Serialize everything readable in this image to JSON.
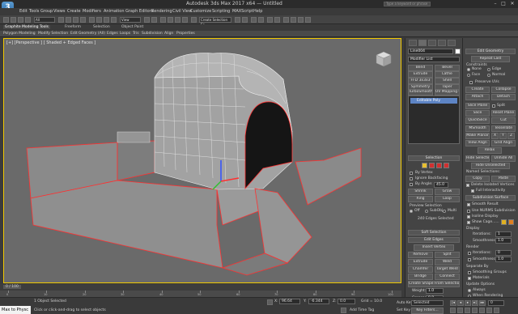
{
  "app": {
    "title": "Autodesk 3ds Max 2017 x64 — Untitled",
    "search_placeholder": "Type a keyword or phrase",
    "logo_letter": "3",
    "workspace": "Workspace: Default"
  },
  "menubar": [
    "Edit",
    "Tools",
    "Group",
    "Views",
    "Create",
    "Modifiers",
    "Animation",
    "Graph Editors",
    "Rendering",
    "Civil View",
    "Customize",
    "Scripting",
    "MAXScript",
    "Help"
  ],
  "toolbar": {
    "filter": "All",
    "view": "View",
    "create_selection_set": "Create Selection Se"
  },
  "ribbon": {
    "tabs": [
      "Graphite Modeling Tools",
      "Freeform",
      "Selection",
      "Object Paint"
    ],
    "active_tab": "Graphite Modeling Tools",
    "subtabs": [
      "Polygon Modeling",
      "Modify Selection",
      "Edit",
      "Geometry (All)",
      "Edges",
      "Loops",
      "Tris",
      "Subdivision",
      "Align",
      "Properties"
    ]
  },
  "viewport": {
    "label": "[+] [Perspective ] [ Shaded + Edged Faces ]"
  },
  "command_panel": {
    "object_name": "Line004",
    "modifier_list": "Modifier List",
    "modifier_buttons": [
      [
        "Bend",
        "Bevel"
      ],
      [
        "Extrude",
        "Lathe"
      ],
      [
        "FFD 3x3x3",
        "Shell"
      ],
      [
        "Symmetry",
        "Taper"
      ],
      [
        "TurboSmooth",
        "UV Mapping Cle"
      ]
    ],
    "stack_item": "Editable Poly",
    "selection": {
      "title": "Selection",
      "by_vertex": "By Vertex",
      "ignore_backfacing": "Ignore Backfacing",
      "by_angle": "By Angle:",
      "angle_value": "45.0",
      "shrink": "Shrink",
      "grow": "Grow",
      "ring": "Ring",
      "loop": "Loop",
      "preview_selection": "Preview Selection",
      "preview_off": "Off",
      "preview_subobj": "SubObj",
      "preview_multi": "Multi",
      "status": "240 Edges Selected"
    },
    "soft_selection": "Soft Selection",
    "edit_edges": {
      "title": "Edit Edges",
      "insert_vertex": "Insert Vertex",
      "remove": "Remove",
      "split": "Split",
      "extrude": "Extrude",
      "weld": "Weld",
      "chamfer": "Chamfer",
      "target_weld": "Target Weld",
      "bridge": "Bridge",
      "connect": "Connect",
      "create_shape": "Create Shape From Selection",
      "weight_label": "Weight:",
      "weight_value": "1.0",
      "crease_label": "Crease:",
      "crease_value": "0.0"
    }
  },
  "right_panel": {
    "edit_geometry": "Edit Geometry",
    "repeat_last": "Repeat Last",
    "constraints": "Constraints",
    "c_none": "None",
    "c_edge": "Edge",
    "c_face": "Face",
    "c_normal": "Normal",
    "preserve_uvs": "Preserve UVs",
    "create": "Create",
    "collapse": "Collapse",
    "attach": "Attach",
    "detach": "Detach",
    "slice_plane": "Slice Plane",
    "split": "Split",
    "slice": "Slice",
    "reset_plane": "Reset Plane",
    "quickslice": "QuickSlice",
    "cut": "Cut",
    "msmooth": "MSmooth",
    "tessellate": "Tessellate",
    "make_planar": "Make Planar",
    "x": "X",
    "y": "Y",
    "z": "Z",
    "view_align": "View Align",
    "grid_align": "Grid Align",
    "relax": "Relax",
    "hide_selected": "Hide Selected",
    "unhide_all": "Unhide All",
    "hide_unselected": "Hide Unselected",
    "named_selections": "Named Selections:",
    "copy": "Copy",
    "paste": "Paste",
    "delete_isolated": "Delete Isolated Vertices",
    "full_interactivity": "Full Interactivity",
    "subdivision_surface": "Subdivision Surface",
    "smooth_result": "Smooth Result",
    "use_nurms": "Use NURMS Subdivision",
    "isoline_display": "Isoline Display",
    "show_cage": "Show Cage......",
    "display": "Display",
    "iterations_label": "Iterations:",
    "iterations_value": "1",
    "smoothness_label": "Smoothness:",
    "smoothness_value": "1.0",
    "render": "Render",
    "r_iterations_value": "0",
    "r_smoothness_value": "1.0",
    "separate_by": "Separate By",
    "smoothing_groups": "Smoothing Groups",
    "materials": "Materials",
    "update_options": "Update Options",
    "always": "Always",
    "when_rendering": "When Rendering",
    "manually": "Manually",
    "cage_color_1": "#e0b020",
    "cage_color_2": "#e08020"
  },
  "timeline": {
    "frame": "0 / 100",
    "ticks": [
      "0",
      "10",
      "20",
      "30",
      "40",
      "50",
      "60",
      "70",
      "80",
      "90",
      "100"
    ]
  },
  "status": {
    "maxscript": "Max to Physc",
    "selection": "1 Object Selected",
    "prompt": "Click or click-and-drag to select objects",
    "x": "96.64",
    "y": "-6.344",
    "z": "0.0",
    "grid": "Grid = 10.0",
    "add_time_tag": "Add Time Tag",
    "autokey": "Auto Key",
    "autokey_mode": "Selected",
    "set_key": "Set Key",
    "key_filters": "Key Filters...",
    "frame_value": "0"
  },
  "accent_colors": {
    "active_viewport_border": "#f0c800",
    "selected_stack": "#5d84c4",
    "selected_edges": "#ff3030"
  }
}
